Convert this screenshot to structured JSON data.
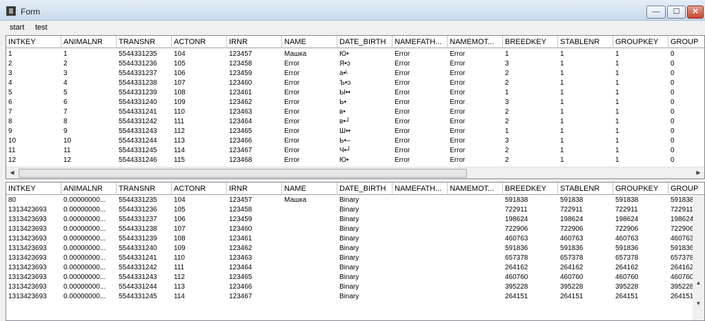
{
  "window": {
    "title": "Form",
    "min": "—",
    "max": "☐",
    "close": "✕"
  },
  "menu": [
    "start",
    "test"
  ],
  "grid1": {
    "columns": [
      "INTKEY",
      "ANIMALNR",
      "TRANSNR",
      "ACTONR",
      "IRNR",
      "NAME",
      "DATE_BIRTH",
      "NAMEFATH...",
      "NAMEMOT...",
      "BREEDKEY",
      "STABLENR",
      "GROUPKEY",
      "GROUP"
    ],
    "rows": [
      [
        "1",
        "1",
        "5544331235",
        "104",
        "123457",
        "Машка",
        "Ю•",
        "Error",
        "Error",
        "1",
        "1",
        "1",
        "0"
      ],
      [
        "2",
        "2",
        "5544331236",
        "105",
        "123458",
        "Error",
        "Я•ↄ",
        "Error",
        "Error",
        "3",
        "1",
        "1",
        "0"
      ],
      [
        "3",
        "3",
        "5544331237",
        "106",
        "123459",
        "Error",
        "а•ᴸ",
        "Error",
        "Error",
        "2",
        "1",
        "1",
        "0"
      ],
      [
        "4",
        "4",
        "5544331238",
        "107",
        "123460",
        "Error",
        "Ъ•ↄ",
        "Error",
        "Error",
        "2",
        "1",
        "1",
        "0"
      ],
      [
        "5",
        "5",
        "5544331239",
        "108",
        "123461",
        "Error",
        "Ы••",
        "Error",
        "Error",
        "1",
        "1",
        "1",
        "0"
      ],
      [
        "6",
        "6",
        "5544331240",
        "109",
        "123462",
        "Error",
        "Ь•",
        "Error",
        "Error",
        "3",
        "1",
        "1",
        "0"
      ],
      [
        "7",
        "7",
        "5544331241",
        "110",
        "123463",
        "Error",
        "в•",
        "Error",
        "Error",
        "2",
        "1",
        "1",
        "0"
      ],
      [
        "8",
        "8",
        "5544331242",
        "111",
        "123464",
        "Error",
        "в•┘",
        "Error",
        "Error",
        "2",
        "1",
        "1",
        "0"
      ],
      [
        "9",
        "9",
        "5544331243",
        "112",
        "123465",
        "Error",
        "Ш••",
        "Error",
        "Error",
        "1",
        "1",
        "1",
        "0"
      ],
      [
        "10",
        "10",
        "5544331244",
        "113",
        "123466",
        "Error",
        "Ь•–",
        "Error",
        "Error",
        "3",
        "1",
        "1",
        "0"
      ],
      [
        "11",
        "11",
        "5544331245",
        "114",
        "123467",
        "Error",
        "Ч•┘",
        "Error",
        "Error",
        "2",
        "1",
        "1",
        "0"
      ],
      [
        "12",
        "12",
        "5544331246",
        "115",
        "123468",
        "Error",
        "Ю•",
        "Error",
        "Error",
        "2",
        "1",
        "1",
        "0"
      ]
    ]
  },
  "grid2": {
    "columns": [
      "INTKEY",
      "ANIMALNR",
      "TRANSNR",
      "ACTONR",
      "IRNR",
      "NAME",
      "DATE_BIRTH",
      "NAMEFATH...",
      "NAMEMOT...",
      "BREEDKEY",
      "STABLENR",
      "GROUPKEY",
      "GROUP"
    ],
    "rows": [
      [
        "80",
        "0.00000000...",
        "5544331235",
        "104",
        "123457",
        "Машка",
        "Binary",
        "",
        "",
        "591838",
        "591838",
        "591838",
        "591838"
      ],
      [
        "1313423693",
        "0.00000000...",
        "5544331236",
        "105",
        "123458",
        "",
        "Binary",
        "",
        "",
        "722911",
        "722911",
        "722911",
        "722911"
      ],
      [
        "1313423693",
        "0.00000000...",
        "5544331237",
        "106",
        "123459",
        "",
        "Binary",
        "",
        "",
        "198624",
        "198624",
        "198624",
        "198624"
      ],
      [
        "1313423693",
        "0.00000000...",
        "5544331238",
        "107",
        "123460",
        "",
        "Binary",
        "",
        "",
        "722906",
        "722906",
        "722906",
        "722906"
      ],
      [
        "1313423693",
        "0.00000000...",
        "5544331239",
        "108",
        "123461",
        "",
        "Binary",
        "",
        "",
        "460763",
        "460763",
        "460763",
        "460763"
      ],
      [
        "1313423693",
        "0.00000000...",
        "5544331240",
        "109",
        "123462",
        "",
        "Binary",
        "",
        "",
        "591836",
        "591836",
        "591836",
        "591836"
      ],
      [
        "1313423693",
        "0.00000000...",
        "5544331241",
        "110",
        "123463",
        "",
        "Binary",
        "",
        "",
        "657378",
        "657378",
        "657378",
        "657378"
      ],
      [
        "1313423693",
        "0.00000000...",
        "5544331242",
        "111",
        "123464",
        "",
        "Binary",
        "",
        "",
        "264162",
        "264162",
        "264162",
        "264162"
      ],
      [
        "1313423693",
        "0.00000000...",
        "5544331243",
        "112",
        "123465",
        "",
        "Binary",
        "",
        "",
        "460760",
        "460760",
        "460760",
        "460760"
      ],
      [
        "1313423693",
        "0.00000000...",
        "5544331244",
        "113",
        "123466",
        "",
        "Binary",
        "",
        "",
        "395228",
        "395228",
        "395228",
        "395228"
      ],
      [
        "1313423693",
        "0.00000000...",
        "5544331245",
        "114",
        "123467",
        "",
        "Binary",
        "",
        "",
        "264151",
        "264151",
        "264151",
        "264151"
      ]
    ]
  },
  "icons": {
    "app": "app-icon",
    "left": "◀",
    "right": "▶",
    "up": "▲",
    "down": "▼"
  }
}
